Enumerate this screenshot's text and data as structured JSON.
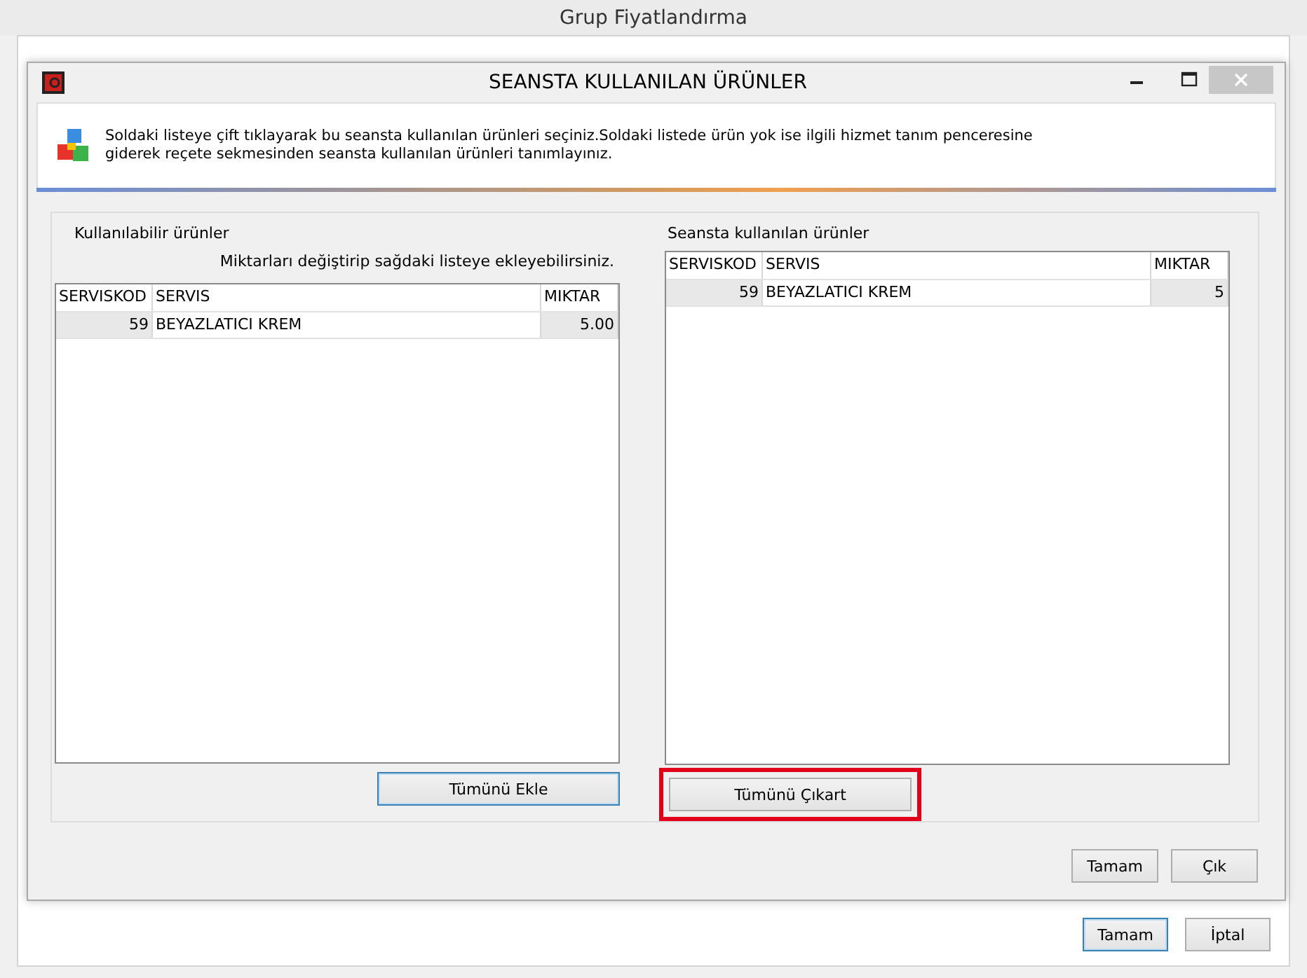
{
  "window": {
    "title": "Grup Fiyatlandırma",
    "buttons": [
      {
        "label": "Tamam",
        "default": true
      },
      {
        "label": "İptal",
        "default": false
      }
    ]
  },
  "dialog": {
    "title": "SEANSTA KULLANILAN ÜRÜNLER",
    "info": "Soldaki listeye çift tıklayarak bu seansta kullanılan ürünleri seçiniz.Soldaki listede ürün yok ise ilgili hizmet tanım penceresine giderek reçete sekmesinden seansta kullanılan ürünleri tanımlayınız.",
    "panels": [
      {
        "label": "Kullanılabilir ürünler",
        "hint": "Miktarları değiştirip sağdaki listeye ekleyebilirsiniz.",
        "columns": [
          "SERVISKOD",
          "SERVIS",
          "MIKTAR"
        ],
        "rows": [
          [
            "59",
            "BEYAZLATICI KREM",
            "5.00"
          ]
        ],
        "button": {
          "label": "Tümünü Ekle",
          "default": true,
          "highlighted": false
        }
      },
      {
        "label": "Seansta kullanılan ürünler",
        "columns": [
          "SERVISKOD",
          "SERVIS",
          "MIKTAR"
        ],
        "rows": [
          [
            "59",
            "BEYAZLATICI KREM",
            "5"
          ]
        ],
        "button": {
          "label": "Tümünü Çıkart",
          "default": false,
          "highlighted": true
        }
      }
    ],
    "buttons": [
      {
        "label": "Tamam"
      },
      {
        "label": "Çık"
      }
    ]
  }
}
